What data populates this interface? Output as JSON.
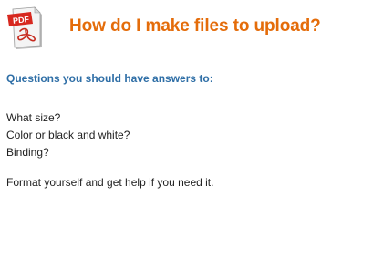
{
  "slide": {
    "icon": "pdf-document-icon",
    "icon_text": "PDF",
    "title": "How do I make files to upload?",
    "subheading": "Questions you should have answers to:",
    "questions": [
      "What size?",
      "Color or black and white?",
      "Binding?"
    ],
    "advice": "Format yourself and get help if you need it.",
    "colors": {
      "title": "#e46c0a",
      "subheading": "#2e6ea6",
      "body_text": "#222222",
      "pdf_red": "#d7281f"
    }
  }
}
